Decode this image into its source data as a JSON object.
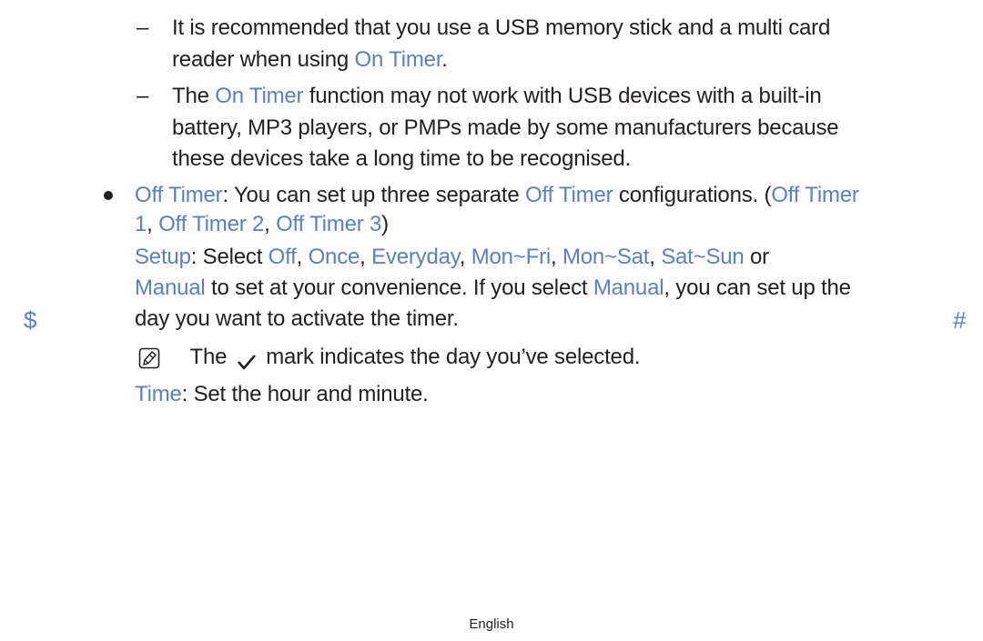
{
  "sub_items": [
    {
      "marker": "–",
      "lines": [
        [
          {
            "t": "It is recommended that you use a USB memory stick and a multi card",
            "h": false
          }
        ],
        [
          {
            "t": "reader when using ",
            "h": false
          },
          {
            "t": "On Timer",
            "h": true
          },
          {
            "t": ".",
            "h": false
          }
        ]
      ]
    },
    {
      "marker": "–",
      "lines": [
        [
          {
            "t": "The ",
            "h": false
          },
          {
            "t": "On Timer",
            "h": true
          },
          {
            "t": " function may not work with USB devices with a built-in",
            "h": false
          }
        ],
        [
          {
            "t": "battery, MP3 players, or PMPs made by some manufacturers because",
            "h": false
          }
        ],
        [
          {
            "t": "these devices take a long time to be recognised.",
            "h": false
          }
        ]
      ]
    }
  ],
  "bullet_item": {
    "lines": [
      [
        {
          "t": "Off Timer",
          "h": true
        },
        {
          "t": ": You can set up three separate ",
          "h": false
        },
        {
          "t": "Off Timer",
          "h": true
        },
        {
          "t": " configurations. (",
          "h": false
        },
        {
          "t": "Off Timer",
          "h": true
        }
      ],
      [
        {
          "t": "1",
          "h": true
        },
        {
          "t": ", ",
          "h": false
        },
        {
          "t": "Off Timer 2",
          "h": true
        },
        {
          "t": ", ",
          "h": false
        },
        {
          "t": "Off Timer 3",
          "h": true
        },
        {
          "t": ")",
          "h": false
        }
      ]
    ]
  },
  "setup": {
    "lines": [
      [
        {
          "t": "Setup",
          "h": true
        },
        {
          "t": ": Select ",
          "h": false
        },
        {
          "t": "Off",
          "h": true
        },
        {
          "t": ", ",
          "h": false
        },
        {
          "t": "Once",
          "h": true
        },
        {
          "t": ", ",
          "h": false
        },
        {
          "t": "Everyday",
          "h": true
        },
        {
          "t": ", ",
          "h": false
        },
        {
          "t": "Mon~Fri",
          "h": true
        },
        {
          "t": ", ",
          "h": false
        },
        {
          "t": "Mon~Sat",
          "h": true
        },
        {
          "t": ", ",
          "h": false
        },
        {
          "t": "Sat~Sun",
          "h": true
        },
        {
          "t": " or",
          "h": false
        }
      ],
      [
        {
          "t": "Manual",
          "h": true
        },
        {
          "t": " to set at your convenience. If you select ",
          "h": false
        },
        {
          "t": "Manual",
          "h": true
        },
        {
          "t": ", you can set up the",
          "h": false
        }
      ],
      [
        {
          "t": "day you want to activate the timer.",
          "h": false
        }
      ]
    ]
  },
  "note": {
    "before_check": "The",
    "after_check": "mark indicates the day you’ve selected."
  },
  "time": {
    "lines": [
      [
        {
          "t": "Time",
          "h": true
        },
        {
          "t": ": Set the hour and minute.",
          "h": false
        }
      ]
    ]
  },
  "side_marks": {
    "left": "$",
    "right": "#"
  },
  "footer": {
    "language": "English"
  },
  "colors": {
    "highlight": "#5b7fc4",
    "text": "#231f20"
  }
}
